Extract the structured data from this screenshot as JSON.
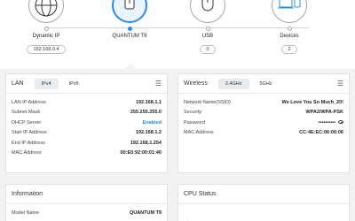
{
  "topology": {
    "nodes": [
      {
        "label": "Dynamic IP",
        "value": "192.168.0.4",
        "icon": "globe-icon"
      },
      {
        "label": "QUANTUM T9",
        "value": "",
        "icon": "router-icon"
      },
      {
        "label": "USB",
        "value": "0",
        "icon": "usb-drive-icon"
      },
      {
        "label": "Devices",
        "value": "2",
        "icon": "devices-icon"
      }
    ],
    "accent": "#2b8ce5"
  },
  "lan": {
    "title": "LAN",
    "tabs": [
      "IPv4",
      "IPv6"
    ],
    "rows": [
      {
        "key": "LAN IP Address",
        "value": "192.168.1.1"
      },
      {
        "key": "Subnet Mask",
        "value": "255.255.255.0"
      },
      {
        "key": "DHCP Server",
        "value": "Enabled"
      },
      {
        "key": "Start IP Address",
        "value": "192.168.1.2"
      },
      {
        "key": "End IP Address",
        "value": "192.168.1.254"
      },
      {
        "key": "MAC Address",
        "value": "00:E0:92:00:01:40"
      }
    ]
  },
  "wireless": {
    "title": "Wireless",
    "tabs": [
      "2.4GHz",
      "5GHz"
    ],
    "rows": [
      {
        "key": "Network Name(SSID)",
        "value": "We Love You So Much_20!"
      },
      {
        "key": "Security",
        "value": "WPA2/WPA-PSK"
      },
      {
        "key": "Password",
        "value": "••••••••••"
      },
      {
        "key": "MAC Address",
        "value": "CC:4E:EC:06:06:06"
      }
    ]
  },
  "information": {
    "title": "Information",
    "rows": [
      {
        "key": "Model Name",
        "value": "QUANTUM T9"
      }
    ]
  },
  "cpu": {
    "title": "CPU Status"
  }
}
